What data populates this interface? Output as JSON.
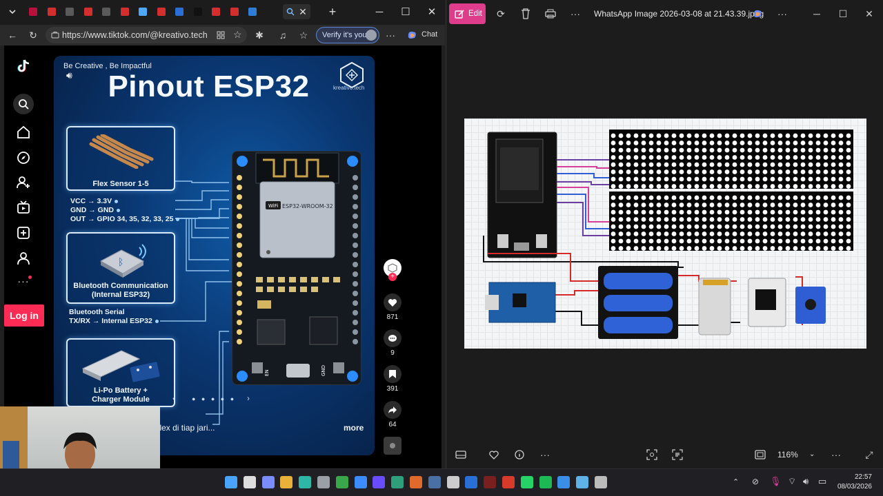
{
  "browser": {
    "url_display": "https://www.tiktok.com/@kreativo.tech...",
    "verify_label": "Verify it's you",
    "chat_label": "Chat",
    "tab_count_favicons": [
      "#b8123c",
      "#d32f2f",
      "#5a5a5a",
      "#d32f2f",
      "#5a5a5a",
      "#d32f2f",
      "#4ea8ff",
      "#d32f2f",
      "#2b6fd6",
      "#111111",
      "#d32f2f",
      "#d32f2f",
      "#2e7dd6"
    ]
  },
  "tiktok": {
    "login_label": "Log in",
    "side_icons": [
      "tiktok-logo",
      "search",
      "home",
      "explore",
      "following",
      "live",
      "upload",
      "profile",
      "more"
    ],
    "video": {
      "tagline": "Be Creative , Be Impactful",
      "title": "Pinout ESP32",
      "brand": "kreativo.tech",
      "flex_card_label": "Flex Sensor 1-5",
      "flex_lines": [
        "VCC → 3.3V",
        "GND → GND",
        "OUT → GPIO 34, 35, 32, 33, 25"
      ],
      "bt_card_label_1": "Bluetooth Communication",
      "bt_card_label_2": "(Internal ESP32)",
      "bt_lines": [
        "Bluetooth Serial",
        "TX/RX → Internal ESP32"
      ],
      "batt_card_label_1": "Li-Po Battery +",
      "batt_card_label_2": "Charger Module",
      "chip_label": "ESP32-WROOM-32",
      "caption": "ung tangan dengan sensor flex di tiap jari...",
      "more": "more"
    },
    "actions": [
      {
        "name": "like",
        "count": "871"
      },
      {
        "name": "comment",
        "count": "9"
      },
      {
        "name": "bookmark",
        "count": "391"
      },
      {
        "name": "share",
        "count": "64"
      }
    ]
  },
  "viewer": {
    "edit_label": "Edit",
    "title": "WhatsApp Image 2026-03-08 at 21.43.39.jpeg",
    "zoom": "116%"
  },
  "taskbar": {
    "time": "22:57",
    "date": "08/03/2026"
  }
}
